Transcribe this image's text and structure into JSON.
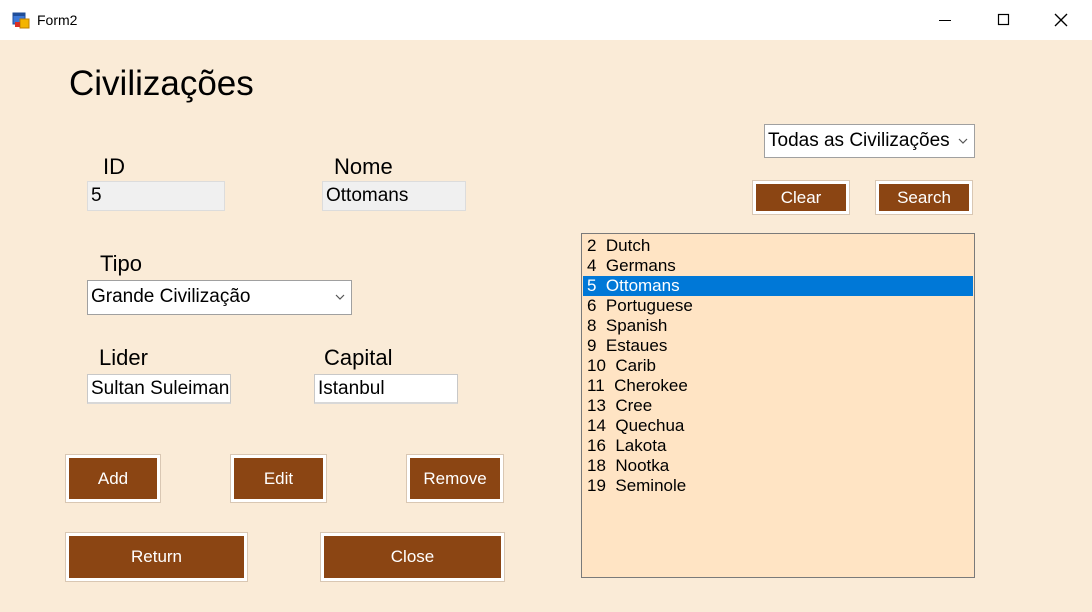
{
  "window": {
    "title": "Form2"
  },
  "form": {
    "heading": "Civilizações",
    "id": {
      "label": "ID",
      "value": "5"
    },
    "nome": {
      "label": "Nome",
      "value": "Ottomans"
    },
    "tipo": {
      "label": "Tipo",
      "value": "Grande Civilização"
    },
    "lider": {
      "label": "Lider",
      "value": "Sultan Suleiman"
    },
    "capital": {
      "label": "Capital",
      "value": "Istanbul"
    },
    "buttons": {
      "add": "Add",
      "edit": "Edit",
      "remove": "Remove",
      "return": "Return",
      "close": "Close"
    }
  },
  "filter": {
    "selected": "Todas as Civilizações",
    "clear": "Clear",
    "search": "Search"
  },
  "list": {
    "items": [
      {
        "id": "2",
        "name": "Dutch"
      },
      {
        "id": "4",
        "name": "Germans"
      },
      {
        "id": "5",
        "name": "Ottomans"
      },
      {
        "id": "6",
        "name": "Portuguese"
      },
      {
        "id": "8",
        "name": "Spanish"
      },
      {
        "id": "9",
        "name": "Estaues"
      },
      {
        "id": "10",
        "name": "Carib"
      },
      {
        "id": "11",
        "name": "Cherokee"
      },
      {
        "id": "13",
        "name": "Cree"
      },
      {
        "id": "14",
        "name": "Quechua"
      },
      {
        "id": "16",
        "name": "Lakota"
      },
      {
        "id": "18",
        "name": "Nootka"
      },
      {
        "id": "19",
        "name": "Seminole"
      }
    ],
    "selected_index": 2
  },
  "colors": {
    "form_bg": "#FAEBD7",
    "button": "#8B4513",
    "list_bg": "#FFE4C4",
    "selection": "#0078D7"
  },
  "icons": {
    "app": "form-app-icon",
    "minimize": "minimize-icon",
    "maximize": "maximize-icon",
    "close": "close-icon",
    "dropdown": "chevron-down-icon"
  }
}
